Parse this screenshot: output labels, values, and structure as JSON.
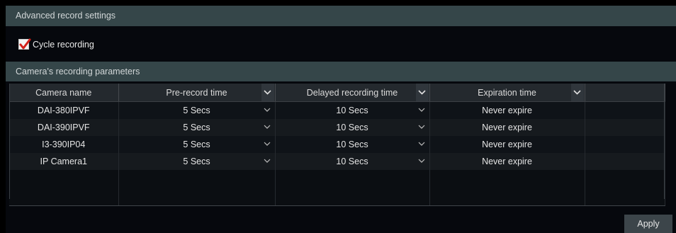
{
  "advanced_header": "Advanced record settings",
  "cycle_recording": {
    "label": "Cycle recording",
    "checked": true
  },
  "params_header": "Camera's recording parameters",
  "table": {
    "columns": [
      "Camera name",
      "Pre-record time",
      "Delayed recording time",
      "Expiration time"
    ],
    "rows": [
      {
        "camera": "DAI-380IPVF",
        "pre_record": "5 Secs",
        "delayed": "10 Secs",
        "expiration": "Never expire"
      },
      {
        "camera": "DAI-390IPVF",
        "pre_record": "5 Secs",
        "delayed": "10 Secs",
        "expiration": "Never expire"
      },
      {
        "camera": "I3-390IP04",
        "pre_record": "5 Secs",
        "delayed": "10 Secs",
        "expiration": "Never expire"
      },
      {
        "camera": "IP Camera1",
        "pre_record": "5 Secs",
        "delayed": "10 Secs",
        "expiration": "Never expire"
      }
    ]
  },
  "apply_label": "Apply",
  "colors": {
    "header_bar": "#354649",
    "checkbox_check": "#d3201a",
    "background": "#06080d"
  }
}
